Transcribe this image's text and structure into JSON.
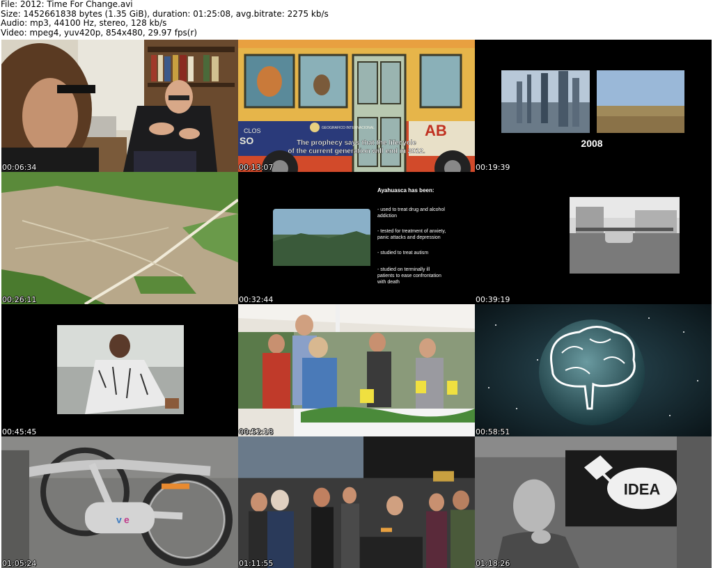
{
  "header": {
    "file_line": "File: 2012: Time For Change.avi",
    "size_line": "Size: 1452661838 bytes (1.35 GiB), duration: 01:25:08, avg.bitrate: 2275 kb/s",
    "audio_line": "Audio: mp3, 44100 Hz, stereo, 128 kb/s",
    "video_line": "Video: mpeg4, yuv420p, 854x480, 29.97 fps(r)"
  },
  "thumbnails": [
    {
      "timestamp": "00:06:34"
    },
    {
      "timestamp": "00:13:07",
      "bus_left": "CLOS",
      "bus_left2": "SO",
      "bus_logo": "GEOGRAFICO INTERNACIONAL",
      "bus_brand": "AB",
      "caption1": "The prophecy says that the lifecycle",
      "caption2": "of the current generation will end in 2012."
    },
    {
      "timestamp": "00:19:39",
      "year": "2008"
    },
    {
      "timestamp": "00:26:11"
    },
    {
      "timestamp": "00:32:44",
      "heading": "Ayahuasca has been:",
      "items": [
        "- used to treat drug and alcohol",
        "addiction",
        "- tested for treatment of anxiety,",
        "panic attacks and depression",
        "- studied to treat autism",
        "- studied on terminally ill",
        "patients to ease confrontation",
        "with death"
      ]
    },
    {
      "timestamp": "00:39:19"
    },
    {
      "timestamp": "00:45:45"
    },
    {
      "timestamp": "00:52:18"
    },
    {
      "timestamp": "00:58:51"
    },
    {
      "timestamp": "01:05:24"
    },
    {
      "timestamp": "01:11:55"
    },
    {
      "timestamp": "01:18:26",
      "sign": "IDEA"
    }
  ]
}
